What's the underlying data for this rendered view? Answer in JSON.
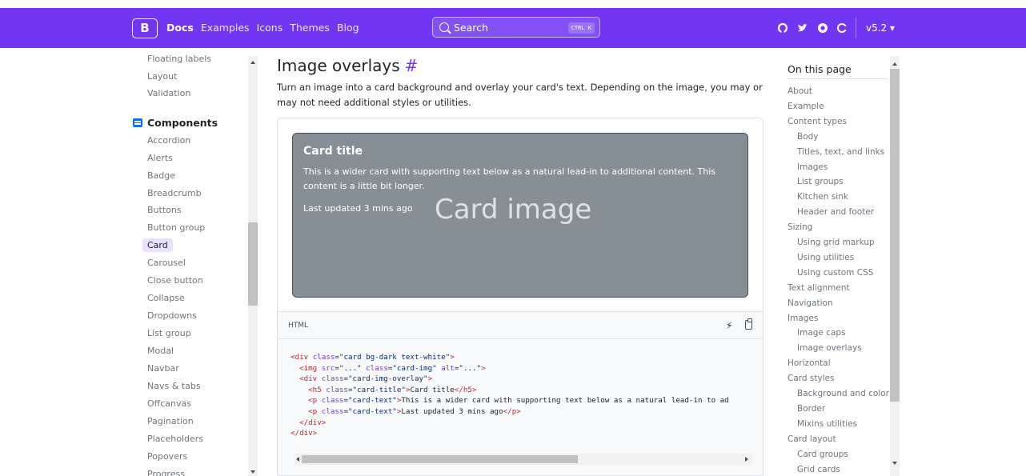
{
  "navbar": {
    "brand": "B",
    "links": [
      "Docs",
      "Examples",
      "Icons",
      "Themes",
      "Blog"
    ],
    "search_label": "Search",
    "search_shortcut": "CTRL K",
    "version": "v5.2 ▾",
    "social_icons": [
      "github-icon",
      "twitter-icon",
      "opencollective-icon",
      "circle-icon"
    ]
  },
  "sidebar": {
    "items_top": [
      "Floating labels",
      "Layout",
      "Validation"
    ],
    "components_label": "Components",
    "components": [
      "Accordion",
      "Alerts",
      "Badge",
      "Breadcrumb",
      "Buttons",
      "Button group",
      "Card",
      "Carousel",
      "Close button",
      "Collapse",
      "Dropdowns",
      "List group",
      "Modal",
      "Navbar",
      "Navs & tabs",
      "Offcanvas",
      "Pagination",
      "Placeholders",
      "Popovers",
      "Progress"
    ],
    "active": "Card"
  },
  "main": {
    "title": "Image overlays",
    "anchor": "#",
    "description": "Turn an image into a card background and overlay your card's text. Depending on the image, you may or may not need additional styles or utilities.",
    "card": {
      "title": "Card title",
      "text": "This is a wider card with supporting text below as a natural lead-in to additional content. This content is a little bit longer.",
      "updated": "Last updated 3 mins ago",
      "image_text": "Card image"
    },
    "code_lang": "HTML"
  },
  "toc": {
    "title": "On this page",
    "items": [
      {
        "label": "About",
        "indent": false
      },
      {
        "label": "Example",
        "indent": false
      },
      {
        "label": "Content types",
        "indent": false
      },
      {
        "label": "Body",
        "indent": true
      },
      {
        "label": "Titles, text, and links",
        "indent": true
      },
      {
        "label": "Images",
        "indent": true
      },
      {
        "label": "List groups",
        "indent": true
      },
      {
        "label": "Kitchen sink",
        "indent": true
      },
      {
        "label": "Header and footer",
        "indent": true
      },
      {
        "label": "Sizing",
        "indent": false
      },
      {
        "label": "Using grid markup",
        "indent": true
      },
      {
        "label": "Using utilities",
        "indent": true
      },
      {
        "label": "Using custom CSS",
        "indent": true
      },
      {
        "label": "Text alignment",
        "indent": false
      },
      {
        "label": "Navigation",
        "indent": false
      },
      {
        "label": "Images",
        "indent": false
      },
      {
        "label": "Image caps",
        "indent": true
      },
      {
        "label": "Image overlays",
        "indent": true
      },
      {
        "label": "Horizontal",
        "indent": false
      },
      {
        "label": "Card styles",
        "indent": false
      },
      {
        "label": "Background and color",
        "indent": true
      },
      {
        "label": "Border",
        "indent": true
      },
      {
        "label": "Mixins utilities",
        "indent": true
      },
      {
        "label": "Card layout",
        "indent": false
      },
      {
        "label": "Card groups",
        "indent": true
      },
      {
        "label": "Grid cards",
        "indent": true
      }
    ]
  },
  "colors": {
    "brand": "#7236f2",
    "card_bg": "#868e96"
  }
}
